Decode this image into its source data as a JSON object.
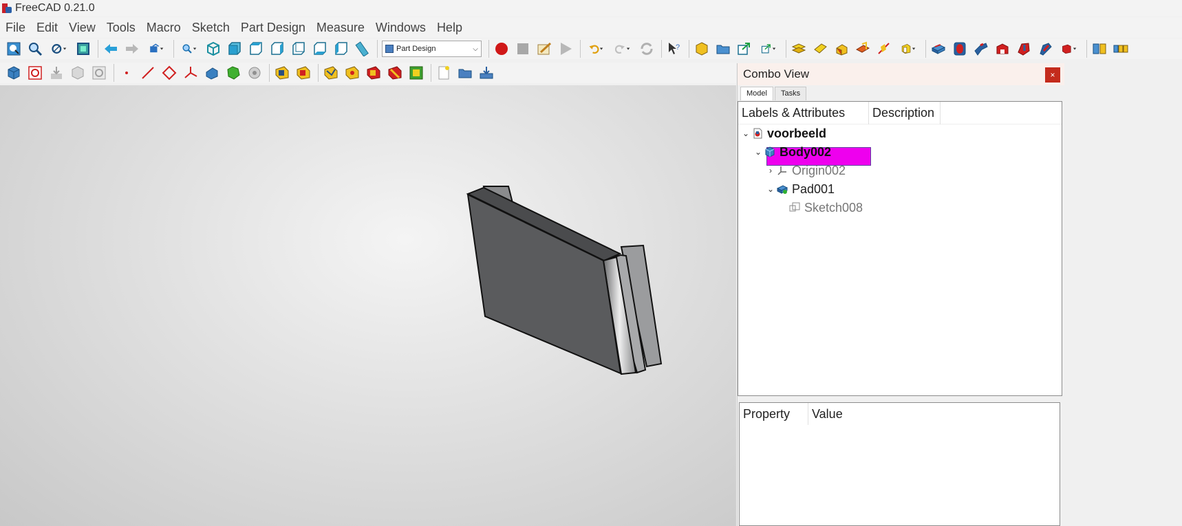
{
  "window": {
    "title": "FreeCAD 0.21.0"
  },
  "menu": [
    "File",
    "Edit",
    "View",
    "Tools",
    "Macro",
    "Sketch",
    "Part Design",
    "Measure",
    "Windows",
    "Help"
  ],
  "workbench": {
    "selected": "Part Design"
  },
  "combo_view": {
    "title": "Combo View",
    "close_label": "×",
    "tabs": [
      "Model",
      "Tasks"
    ],
    "tree_columns": [
      "Labels & Attributes",
      "Description"
    ],
    "tree": [
      {
        "label": "voorbeeld",
        "expanded": true
      },
      {
        "label": "Body002",
        "expanded": true,
        "selected": true
      },
      {
        "label": "Origin002",
        "expanded": false
      },
      {
        "label": "Pad001",
        "expanded": true
      },
      {
        "label": "Sketch008"
      }
    ],
    "property_columns": [
      "Property",
      "Value"
    ]
  },
  "colors": {
    "selection": "#ee00ee",
    "model_face": "#5a5b5d",
    "record_button": "#d01818"
  }
}
